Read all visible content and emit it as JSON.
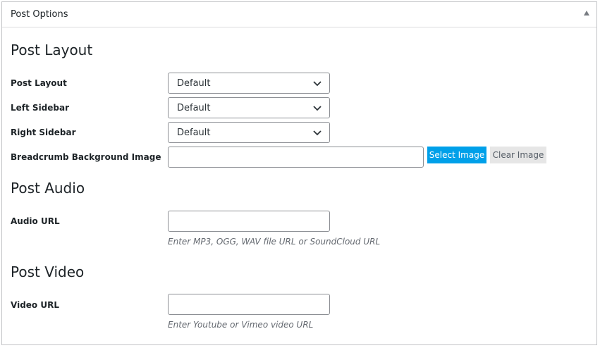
{
  "metabox": {
    "title": "Post Options"
  },
  "sections": {
    "layout": {
      "title": "Post Layout",
      "fields": {
        "post_layout": {
          "label": "Post Layout",
          "value": "Default"
        },
        "left_sidebar": {
          "label": "Left Sidebar",
          "value": "Default"
        },
        "right_sidebar": {
          "label": "Right Sidebar",
          "value": "Default"
        },
        "breadcrumb_bg": {
          "label": "Breadcrumb Background Image",
          "value": "",
          "select_label": "Select Image",
          "clear_label": "Clear Image"
        }
      }
    },
    "audio": {
      "title": "Post Audio",
      "fields": {
        "audio_url": {
          "label": "Audio URL",
          "value": "",
          "help": "Enter MP3, OGG, WAV file URL or SoundCloud URL"
        }
      }
    },
    "video": {
      "title": "Post Video",
      "fields": {
        "video_url": {
          "label": "Video URL",
          "value": "",
          "help": "Enter Youtube or Vimeo video URL"
        }
      }
    }
  },
  "icons": {
    "toggle": "triangle-up-icon",
    "dropdown": "chevron-down-icon"
  },
  "colors": {
    "select_button_bg": "#00a0e9",
    "clear_button_bg": "#e6e6e6",
    "border": "#8c8f94"
  }
}
